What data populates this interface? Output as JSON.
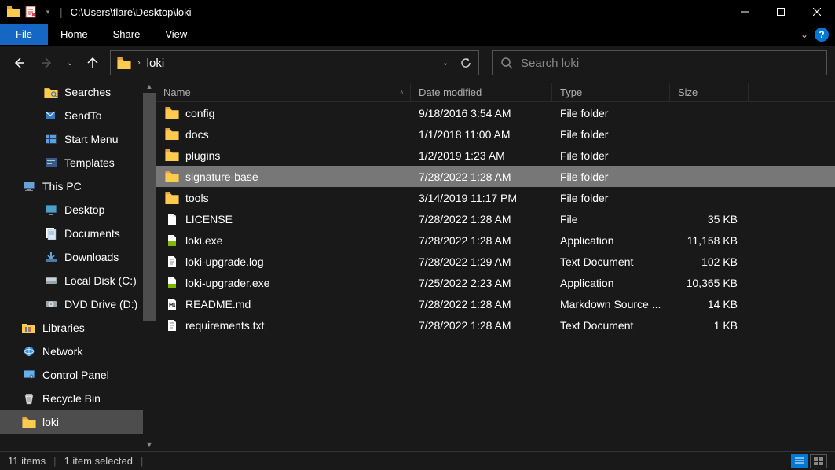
{
  "titlebar": {
    "path": "C:\\Users\\flare\\Desktop\\loki"
  },
  "ribbon": {
    "file": "File",
    "tabs": [
      "Home",
      "Share",
      "View"
    ]
  },
  "address": {
    "segment": "loki"
  },
  "search": {
    "placeholder": "Search loki"
  },
  "columns": {
    "name": "Name",
    "date": "Date modified",
    "type": "Type",
    "size": "Size"
  },
  "sidebar": [
    {
      "label": "Searches",
      "icon": "folder-search",
      "indent": 1
    },
    {
      "label": "SendTo",
      "icon": "sendto",
      "indent": 1
    },
    {
      "label": "Start Menu",
      "icon": "startmenu",
      "indent": 1
    },
    {
      "label": "Templates",
      "icon": "templates",
      "indent": 1
    },
    {
      "label": "This PC",
      "icon": "thispc",
      "indent": 0
    },
    {
      "label": "Desktop",
      "icon": "desktop",
      "indent": 1
    },
    {
      "label": "Documents",
      "icon": "documents",
      "indent": 1
    },
    {
      "label": "Downloads",
      "icon": "downloads",
      "indent": 1
    },
    {
      "label": "Local Disk (C:)",
      "icon": "disk",
      "indent": 1
    },
    {
      "label": "DVD Drive (D:)",
      "icon": "dvd",
      "indent": 1
    },
    {
      "label": "Libraries",
      "icon": "libraries",
      "indent": 0
    },
    {
      "label": "Network",
      "icon": "network",
      "indent": 0
    },
    {
      "label": "Control Panel",
      "icon": "controlpanel",
      "indent": 0
    },
    {
      "label": "Recycle Bin",
      "icon": "recycle",
      "indent": 0
    },
    {
      "label": "loki",
      "icon": "folder",
      "indent": 0,
      "current": true
    }
  ],
  "files": [
    {
      "name": "config",
      "date": "9/18/2016 3:54 AM",
      "type": "File folder",
      "size": "",
      "icon": "folder"
    },
    {
      "name": "docs",
      "date": "1/1/2018 11:00 AM",
      "type": "File folder",
      "size": "",
      "icon": "folder"
    },
    {
      "name": "plugins",
      "date": "1/2/2019 1:23 AM",
      "type": "File folder",
      "size": "",
      "icon": "folder"
    },
    {
      "name": "signature-base",
      "date": "7/28/2022 1:28 AM",
      "type": "File folder",
      "size": "",
      "icon": "folder",
      "selected": true
    },
    {
      "name": "tools",
      "date": "3/14/2019 11:17 PM",
      "type": "File folder",
      "size": "",
      "icon": "folder"
    },
    {
      "name": "LICENSE",
      "date": "7/28/2022 1:28 AM",
      "type": "File",
      "size": "35 KB",
      "icon": "file"
    },
    {
      "name": "loki.exe",
      "date": "7/28/2022 1:28 AM",
      "type": "Application",
      "size": "11,158 KB",
      "icon": "exe"
    },
    {
      "name": "loki-upgrade.log",
      "date": "7/28/2022 1:29 AM",
      "type": "Text Document",
      "size": "102 KB",
      "icon": "text"
    },
    {
      "name": "loki-upgrader.exe",
      "date": "7/25/2022 2:23 AM",
      "type": "Application",
      "size": "10,365 KB",
      "icon": "exe"
    },
    {
      "name": "README.md",
      "date": "7/28/2022 1:28 AM",
      "type": "Markdown Source ...",
      "size": "14 KB",
      "icon": "md"
    },
    {
      "name": "requirements.txt",
      "date": "7/28/2022 1:28 AM",
      "type": "Text Document",
      "size": "1 KB",
      "icon": "text"
    }
  ],
  "statusbar": {
    "count": "11 items",
    "selected": "1 item selected"
  }
}
